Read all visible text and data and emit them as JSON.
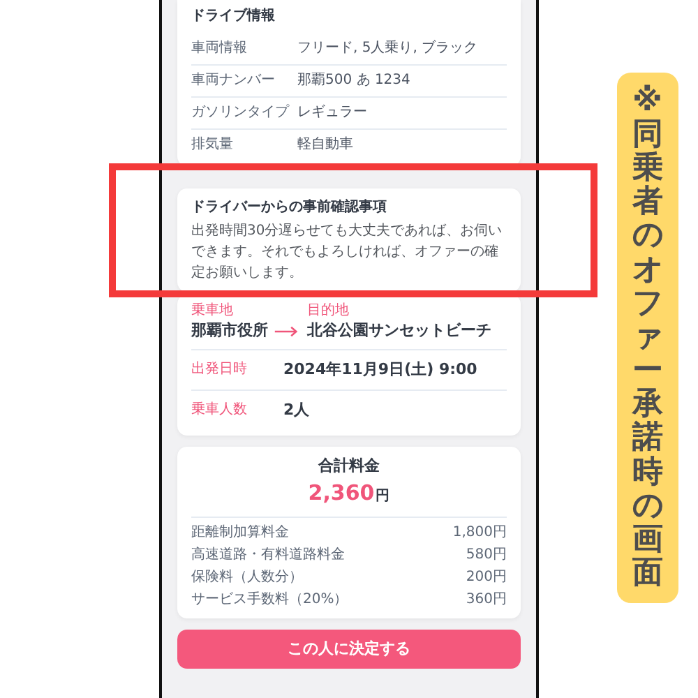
{
  "drive_info": {
    "title": "ドライブ情報",
    "rows": [
      {
        "label": "車両情報",
        "value": "フリード, 5人乗り, ブラック"
      },
      {
        "label": "車両ナンバー",
        "value": "那覇500 あ 1234"
      },
      {
        "label": "ガソリンタイプ",
        "value": "レギュラー"
      },
      {
        "label": "排気量",
        "value": "軽自動車"
      }
    ]
  },
  "notice": {
    "title": "ドライバーからの事前確認事項",
    "body": "出発時間30分遅らせても大丈夫であれば、お伺いできます。それでもよろしければ、オファーの確定お願いします。"
  },
  "route": {
    "origin_label": "乗車地",
    "origin": "那覇市役所",
    "destination_label": "目的地",
    "destination": "北谷公園サンセットビーチ"
  },
  "details": [
    {
      "label": "出発日時",
      "value": "2024年11月9日(土) 9:00"
    },
    {
      "label": "乗車人数",
      "value": "2人"
    }
  ],
  "fare": {
    "title": "合計料金",
    "total": "2,360",
    "unit": "円",
    "items": [
      {
        "label": "距離制加算料金",
        "amount": "1,800円"
      },
      {
        "label": "高速道路・有料道路料金",
        "amount": "580円"
      },
      {
        "label": "保険料（人数分）",
        "amount": "200円"
      },
      {
        "label": "サービス手数料（20%）",
        "amount": "360円"
      }
    ]
  },
  "button": "この人に決定する",
  "side_note": "※同乗者のオファー承諾時の画面"
}
